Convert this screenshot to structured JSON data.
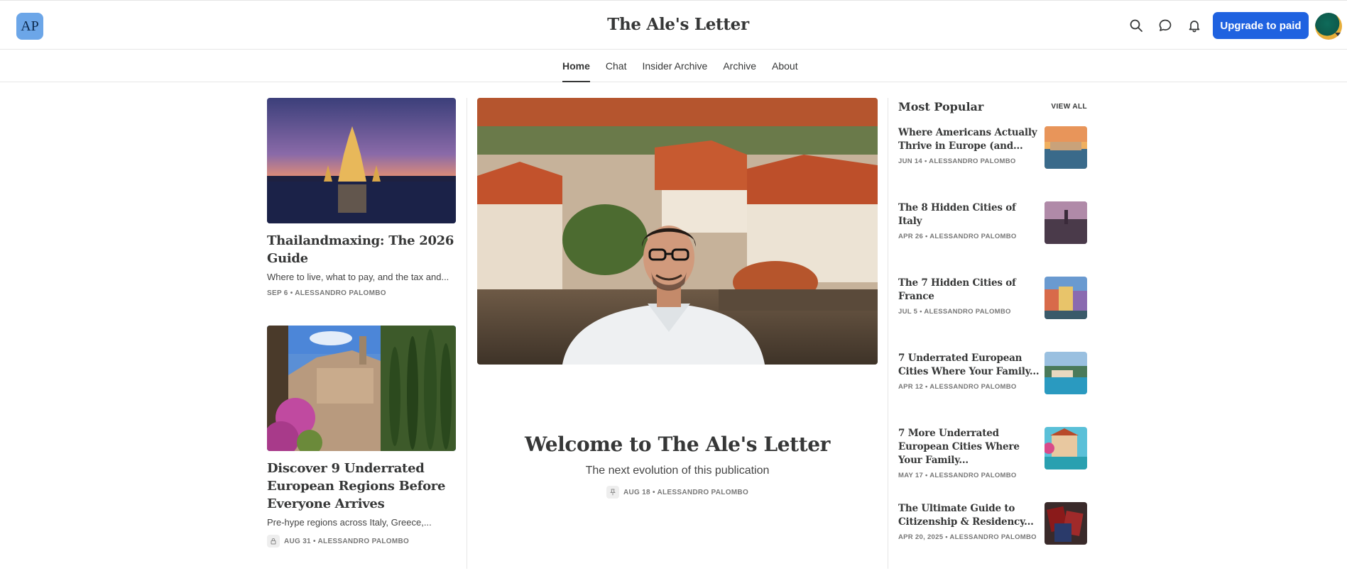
{
  "header": {
    "logo_text": "AP",
    "site_title": "The Ale's Letter",
    "upgrade_label": "Upgrade to paid",
    "icons": [
      "search-icon",
      "chat-bubble-icon",
      "bell-icon"
    ]
  },
  "nav": {
    "items": [
      {
        "label": "Home",
        "active": true
      },
      {
        "label": "Chat",
        "active": false
      },
      {
        "label": "Insider Archive",
        "active": false
      },
      {
        "label": "Archive",
        "active": false
      },
      {
        "label": "About",
        "active": false
      }
    ]
  },
  "left_posts": [
    {
      "title": "Thailandmaxing: The 2026 Guide",
      "subtitle": "Where to live, what to pay, and the tax and...",
      "meta": "SEP 6 • ALESSANDRO PALOMBO",
      "locked": false
    },
    {
      "title": "Discover 9 Underrated European Regions Before Everyone Arrives",
      "subtitle": "Pre-hype regions across Italy, Greece,...",
      "meta": "AUG 31 • ALESSANDRO PALOMBO",
      "locked": true
    }
  ],
  "hero": {
    "title": "Welcome to The Ale's Letter",
    "subtitle": "The next evolution of this publication",
    "meta": "AUG 18 • ALESSANDRO PALOMBO",
    "pinned": true
  },
  "popular": {
    "heading": "Most Popular",
    "view_all": "VIEW ALL",
    "items": [
      {
        "title": "Where Americans Actually Thrive in Europe (and...",
        "meta": "JUN 14 • ALESSANDRO PALOMBO"
      },
      {
        "title": "The 8 Hidden Cities of Italy",
        "meta": "APR 26 • ALESSANDRO PALOMBO"
      },
      {
        "title": "The 7 Hidden Cities of France",
        "meta": "JUL 5 • ALESSANDRO PALOMBO"
      },
      {
        "title": "7 Underrated European Cities Where Your Family...",
        "meta": "APR 12 • ALESSANDRO PALOMBO"
      },
      {
        "title": "7 More Underrated European Cities Where Your Family...",
        "meta": "MAY 17 • ALESSANDRO PALOMBO"
      },
      {
        "title": "The Ultimate Guide to Citizenship & Residency...",
        "meta": "APR 20, 2025 • ALESSANDRO PALOMBO"
      }
    ]
  },
  "colors": {
    "accent": "#1f62e0",
    "text": "#363737",
    "muted": "#777777",
    "border": "#e6e6e6"
  }
}
